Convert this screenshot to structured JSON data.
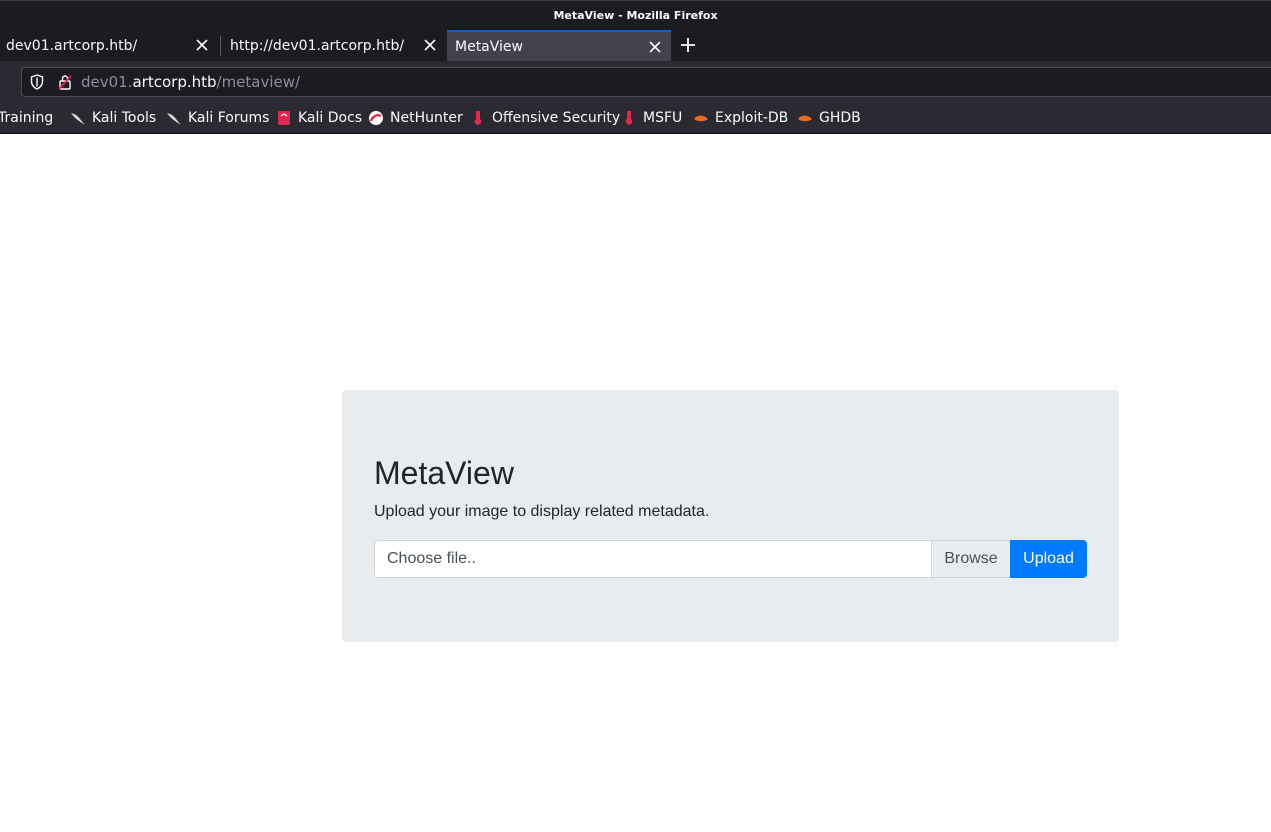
{
  "window": {
    "title": "MetaView - Mozilla Firefox"
  },
  "tabs": [
    {
      "label": "dev01.artcorp.htb/",
      "active": false
    },
    {
      "label": "http://dev01.artcorp.htb/",
      "active": false
    },
    {
      "label": "MetaView",
      "active": true
    }
  ],
  "urlbar": {
    "host_prefix": "dev01.",
    "host": "artcorp.htb",
    "path": "/metaview/"
  },
  "bookmarks": [
    {
      "label": "Training",
      "icon": "kali-dragon-icon"
    },
    {
      "label": "Kali Tools",
      "icon": "kali-dragon-icon"
    },
    {
      "label": "Kali Forums",
      "icon": "kali-dragon-icon"
    },
    {
      "label": "Kali Docs",
      "icon": "kali-docs-icon"
    },
    {
      "label": "NetHunter",
      "icon": "nethunter-icon"
    },
    {
      "label": "Offensive Security",
      "icon": "offsec-icon"
    },
    {
      "label": "MSFU",
      "icon": "offsec-icon"
    },
    {
      "label": "Exploit-DB",
      "icon": "exploitdb-icon"
    },
    {
      "label": "GHDB",
      "icon": "exploitdb-icon"
    }
  ],
  "page": {
    "title": "MetaView",
    "lead": "Upload your image to display related metadata.",
    "file_placeholder": "Choose file..",
    "browse_label": "Browse",
    "upload_label": "Upload"
  },
  "colors": {
    "accent": "#007bff",
    "tab_highlight": "#0060df",
    "chrome_dark": "#1c1b22"
  }
}
